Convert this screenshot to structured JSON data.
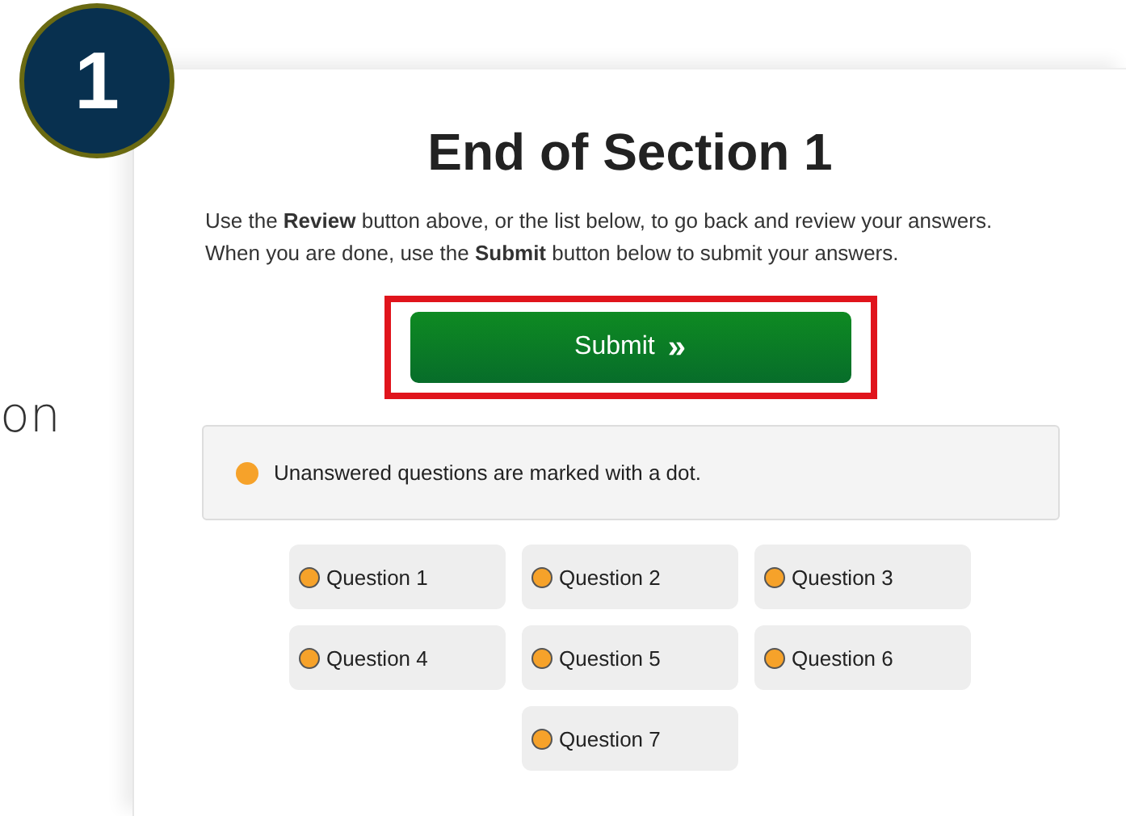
{
  "step_badge": "1",
  "side_text": "on",
  "title": "End of Section 1",
  "instructions": [
    "Use the **Review** button above, or the list below, to go back and review your answers.",
    "When you are done, use the **Submit** button below to submit your answers."
  ],
  "submit": {
    "label": "Submit",
    "icon": "»",
    "highlighted": true
  },
  "legend": "Unanswered questions are marked with a dot.",
  "questions": [
    {
      "label": "Question 1",
      "answered": false
    },
    {
      "label": "Question 2",
      "answered": false
    },
    {
      "label": "Question 3",
      "answered": false
    },
    {
      "label": "Question 4",
      "answered": false
    },
    {
      "label": "Question 5",
      "answered": false
    },
    {
      "label": "Question 6",
      "answered": false
    },
    {
      "label": "Question 7",
      "answered": false
    }
  ]
}
